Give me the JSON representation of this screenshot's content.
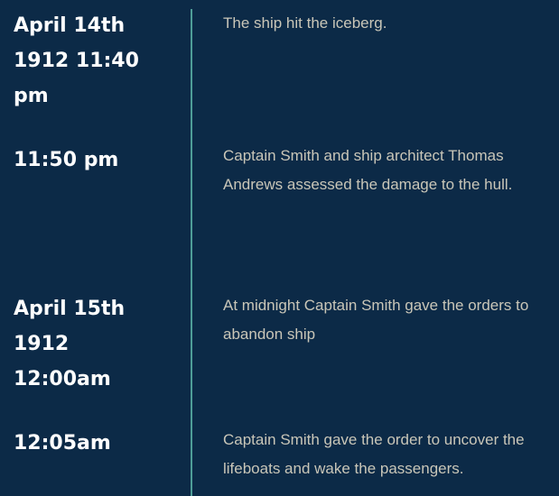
{
  "colors": {
    "background": "#0c2a47",
    "divider": "#4e9d97",
    "time_text": "#ffffff",
    "description_text": "#c9c6b8"
  },
  "events": [
    {
      "time_lines": [
        "April 14th",
        "1912 11:40",
        "pm"
      ],
      "description": "The ship hit the iceberg."
    },
    {
      "time_lines": [
        "11:50 pm"
      ],
      "description": "Captain Smith and ship architect Thomas Andrews assessed the damage to the hull."
    },
    {
      "time_lines": [
        "April 15th",
        "1912",
        "12:00am"
      ],
      "description": "At midnight Captain Smith gave the orders to abandon ship"
    },
    {
      "time_lines": [
        "12:05am"
      ],
      "description": "Captain Smith gave the order to uncover the lifeboats and wake the passengers."
    }
  ]
}
